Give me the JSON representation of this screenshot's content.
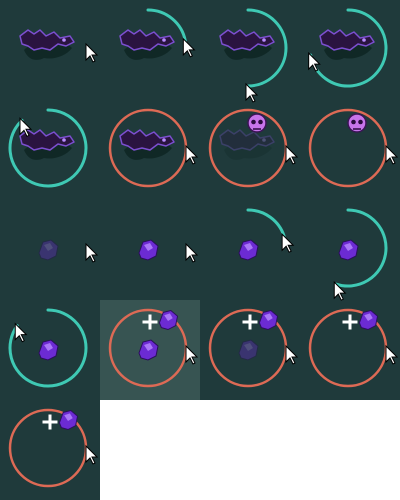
{
  "sheet": {
    "background_color": "#1f3a3b",
    "selected_cell_color": "#375452",
    "empty_color": "#ffffff"
  },
  "colors": {
    "progress_ring": "#3fc9b4",
    "range_ring": "#dd6a55",
    "shadow": "#0d2422",
    "creature": "#2a1440",
    "creature_edge": "#7c4fd0",
    "gem": "#6c2bd3",
    "gem_light": "#b98bff",
    "skull": "#c774ea",
    "cursor": "#ffffff",
    "plus": "#ffffff"
  },
  "frames": [
    {
      "index": 1,
      "subject": "shadow-creature",
      "ring": "none",
      "progress": 0,
      "cursor": true,
      "creature_faded": false,
      "skull_icon": false,
      "plus_icon": false,
      "held_gem": false,
      "subject_visible": true
    },
    {
      "index": 2,
      "subject": "shadow-creature",
      "ring": "progress",
      "progress": 0.22,
      "cursor": true,
      "creature_faded": false,
      "skull_icon": false,
      "plus_icon": false,
      "held_gem": false,
      "subject_visible": true
    },
    {
      "index": 3,
      "subject": "shadow-creature",
      "ring": "progress",
      "progress": 0.5,
      "cursor": true,
      "creature_faded": false,
      "skull_icon": false,
      "plus_icon": false,
      "held_gem": false,
      "subject_visible": true
    },
    {
      "index": 4,
      "subject": "shadow-creature",
      "ring": "progress",
      "progress": 0.72,
      "cursor": true,
      "creature_faded": false,
      "skull_icon": false,
      "plus_icon": false,
      "held_gem": false,
      "subject_visible": true
    },
    {
      "index": 5,
      "subject": "shadow-creature",
      "ring": "progress",
      "progress": 0.88,
      "cursor": true,
      "creature_faded": false,
      "skull_icon": false,
      "plus_icon": false,
      "held_gem": false,
      "subject_visible": true
    },
    {
      "index": 6,
      "subject": "shadow-creature",
      "ring": "range",
      "progress": 1,
      "cursor": true,
      "creature_faded": false,
      "skull_icon": false,
      "plus_icon": false,
      "held_gem": false,
      "subject_visible": true
    },
    {
      "index": 7,
      "subject": "shadow-creature",
      "ring": "range",
      "progress": 1,
      "cursor": true,
      "creature_faded": true,
      "skull_icon": true,
      "plus_icon": false,
      "held_gem": false,
      "subject_visible": true
    },
    {
      "index": 8,
      "subject": "shadow-creature",
      "ring": "range",
      "progress": 1,
      "cursor": true,
      "creature_faded": false,
      "skull_icon": true,
      "plus_icon": false,
      "held_gem": false,
      "subject_visible": false
    },
    {
      "index": 9,
      "subject": "soul-gem",
      "ring": "none",
      "progress": 0,
      "cursor": true,
      "creature_faded": true,
      "skull_icon": false,
      "plus_icon": false,
      "held_gem": false,
      "subject_visible": true
    },
    {
      "index": 10,
      "subject": "soul-gem",
      "ring": "none",
      "progress": 0,
      "cursor": true,
      "creature_faded": false,
      "skull_icon": false,
      "plus_icon": false,
      "held_gem": false,
      "subject_visible": true
    },
    {
      "index": 11,
      "subject": "soul-gem",
      "ring": "progress",
      "progress": 0.2,
      "cursor": true,
      "creature_faded": false,
      "skull_icon": false,
      "plus_icon": false,
      "held_gem": false,
      "subject_visible": true
    },
    {
      "index": 12,
      "subject": "soul-gem",
      "ring": "progress",
      "progress": 0.55,
      "cursor": true,
      "creature_faded": false,
      "skull_icon": false,
      "plus_icon": false,
      "held_gem": false,
      "subject_visible": true
    },
    {
      "index": 13,
      "subject": "soul-gem",
      "ring": "progress",
      "progress": 0.85,
      "cursor": true,
      "creature_faded": false,
      "skull_icon": false,
      "plus_icon": false,
      "held_gem": false,
      "subject_visible": true
    },
    {
      "index": 14,
      "subject": "soul-gem",
      "ring": "range",
      "progress": 1,
      "cursor": true,
      "creature_faded": false,
      "skull_icon": false,
      "plus_icon": true,
      "held_gem": true,
      "subject_visible": true,
      "selected": true
    },
    {
      "index": 15,
      "subject": "soul-gem",
      "ring": "range",
      "progress": 1,
      "cursor": true,
      "creature_faded": true,
      "skull_icon": false,
      "plus_icon": true,
      "held_gem": true,
      "subject_visible": true
    },
    {
      "index": 16,
      "subject": "soul-gem",
      "ring": "range",
      "progress": 1,
      "cursor": true,
      "creature_faded": false,
      "skull_icon": false,
      "plus_icon": true,
      "held_gem": true,
      "subject_visible": false
    },
    {
      "index": 17,
      "subject": "soul-gem",
      "ring": "range",
      "progress": 1,
      "cursor": true,
      "creature_faded": false,
      "skull_icon": false,
      "plus_icon": true,
      "held_gem": true,
      "subject_visible": false
    }
  ]
}
